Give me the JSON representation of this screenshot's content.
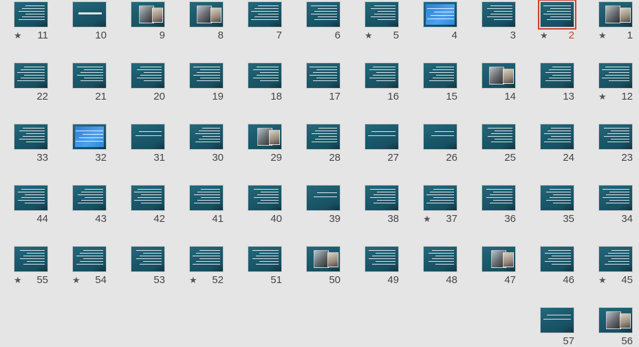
{
  "view": "slide-sorter",
  "accent_selected": "#c7452e",
  "slides": [
    {
      "n": "1",
      "star": true,
      "kind": "image"
    },
    {
      "n": "2",
      "star": true,
      "kind": "text",
      "selected": true
    },
    {
      "n": "3",
      "star": false,
      "kind": "text"
    },
    {
      "n": "4",
      "star": false,
      "kind": "blue"
    },
    {
      "n": "5",
      "star": true,
      "kind": "text"
    },
    {
      "n": "6",
      "star": false,
      "kind": "text"
    },
    {
      "n": "7",
      "star": false,
      "kind": "text"
    },
    {
      "n": "8",
      "star": false,
      "kind": "image"
    },
    {
      "n": "9",
      "star": false,
      "kind": "image"
    },
    {
      "n": "10",
      "star": false,
      "kind": "title"
    },
    {
      "n": "11",
      "star": true,
      "kind": "text"
    },
    {
      "n": "12",
      "star": true,
      "kind": "text"
    },
    {
      "n": "13",
      "star": false,
      "kind": "text"
    },
    {
      "n": "14",
      "star": false,
      "kind": "image"
    },
    {
      "n": "15",
      "star": false,
      "kind": "text"
    },
    {
      "n": "16",
      "star": false,
      "kind": "text"
    },
    {
      "n": "17",
      "star": false,
      "kind": "text"
    },
    {
      "n": "18",
      "star": false,
      "kind": "text"
    },
    {
      "n": "19",
      "star": false,
      "kind": "text"
    },
    {
      "n": "20",
      "star": false,
      "kind": "text"
    },
    {
      "n": "21",
      "star": false,
      "kind": "text"
    },
    {
      "n": "22",
      "star": false,
      "kind": "text"
    },
    {
      "n": "23",
      "star": false,
      "kind": "text"
    },
    {
      "n": "24",
      "star": false,
      "kind": "text"
    },
    {
      "n": "25",
      "star": false,
      "kind": "text"
    },
    {
      "n": "26",
      "star": false,
      "kind": "sparse"
    },
    {
      "n": "27",
      "star": false,
      "kind": "sparse"
    },
    {
      "n": "28",
      "star": false,
      "kind": "text"
    },
    {
      "n": "29",
      "star": false,
      "kind": "image"
    },
    {
      "n": "30",
      "star": false,
      "kind": "text"
    },
    {
      "n": "31",
      "star": false,
      "kind": "sparse"
    },
    {
      "n": "32",
      "star": false,
      "kind": "blue"
    },
    {
      "n": "33",
      "star": false,
      "kind": "text"
    },
    {
      "n": "34",
      "star": false,
      "kind": "text"
    },
    {
      "n": "35",
      "star": false,
      "kind": "text"
    },
    {
      "n": "36",
      "star": false,
      "kind": "text"
    },
    {
      "n": "37",
      "star": true,
      "kind": "text"
    },
    {
      "n": "38",
      "star": false,
      "kind": "text"
    },
    {
      "n": "39",
      "star": false,
      "kind": "sparse"
    },
    {
      "n": "40",
      "star": false,
      "kind": "text"
    },
    {
      "n": "41",
      "star": false,
      "kind": "text"
    },
    {
      "n": "42",
      "star": false,
      "kind": "text"
    },
    {
      "n": "43",
      "star": false,
      "kind": "text"
    },
    {
      "n": "44",
      "star": false,
      "kind": "text"
    },
    {
      "n": "45",
      "star": true,
      "kind": "text"
    },
    {
      "n": "46",
      "star": false,
      "kind": "text"
    },
    {
      "n": "47",
      "star": false,
      "kind": "image"
    },
    {
      "n": "48",
      "star": false,
      "kind": "text"
    },
    {
      "n": "49",
      "star": false,
      "kind": "text"
    },
    {
      "n": "50",
      "star": false,
      "kind": "image"
    },
    {
      "n": "51",
      "star": false,
      "kind": "text"
    },
    {
      "n": "52",
      "star": true,
      "kind": "text"
    },
    {
      "n": "53",
      "star": false,
      "kind": "text"
    },
    {
      "n": "54",
      "star": true,
      "kind": "text"
    },
    {
      "n": "55",
      "star": true,
      "kind": "text"
    },
    {
      "n": "56",
      "star": false,
      "kind": "image"
    },
    {
      "n": "57",
      "star": false,
      "kind": "sparse"
    }
  ]
}
